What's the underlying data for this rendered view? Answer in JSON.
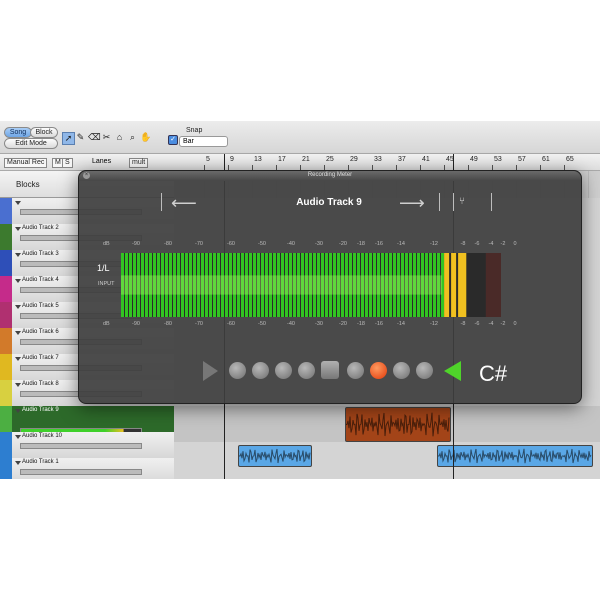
{
  "toolbar": {
    "song_label": "Song",
    "block_label": "Block",
    "edit_mode_label": "Edit Mode",
    "snap_label": "Snap",
    "snap_value": "Bar",
    "tools": [
      "pointer-tool-icon",
      "pencil-tool-icon",
      "eraser-tool-icon",
      "scissors-tool-icon",
      "glue-tool-icon",
      "magnify-tool-icon",
      "hand-tool-icon"
    ]
  },
  "header_row": {
    "manual_rec_label": "Manual Rec",
    "m_label": "M",
    "s_label": "S",
    "lanes_label": "Lanes",
    "lanes_value": "mult",
    "ruler_ticks": [
      "5",
      "9",
      "13",
      "17",
      "21",
      "25",
      "29",
      "33",
      "37",
      "41",
      "45",
      "49",
      "53",
      "57",
      "61",
      "65"
    ]
  },
  "blocks_label": "Blocks",
  "tracks": [
    {
      "name": "",
      "color": "#4a6fd0"
    },
    {
      "name": "Audio Track 2",
      "color": "#3c7a2e"
    },
    {
      "name": "Audio Track 3",
      "color": "#2e4fb8"
    },
    {
      "name": "Audio Track 4",
      "color": "#c52b8a"
    },
    {
      "name": "Audio Track 5",
      "color": "#b03070"
    },
    {
      "name": "Audio Track 6",
      "color": "#d27a2a"
    },
    {
      "name": "Audio Track 7",
      "color": "#e0b820"
    },
    {
      "name": "Audio Track 8",
      "color": "#d8d040"
    },
    {
      "name": "Audio Track 9",
      "color": "#4caf42"
    },
    {
      "name": "Audio Track 10",
      "color": "#2d7ed0"
    },
    {
      "name": "Audio Track 1",
      "color": "#2d7ed0"
    }
  ],
  "meter": {
    "window_title": "Recording Meter",
    "track_name": "Audio Track 9",
    "channel_label": "1/L",
    "input_label": "INPUT",
    "db_label": "dB",
    "scale": [
      "-90",
      "-80",
      "-70",
      "-60",
      "-50",
      "-40",
      "-30",
      "-20",
      "-18",
      "-16",
      "-14",
      "-12",
      "-8",
      "-6",
      "-4",
      "-2",
      "0"
    ],
    "level_fraction": 0.9,
    "key_label": "C#",
    "colors": {
      "green": "#33cc22",
      "yellow": "#f0c020",
      "record": "#ff4a10",
      "play_arrow": "#55dd33"
    }
  }
}
